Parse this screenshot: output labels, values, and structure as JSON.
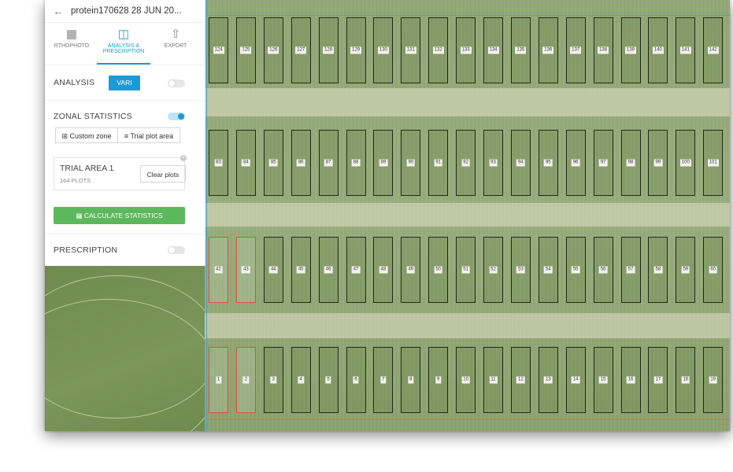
{
  "header": {
    "title": "protein170628 28 JUN 20..."
  },
  "tabs": [
    {
      "label": "RTHOPHOTO",
      "icon": "grid-map-icon"
    },
    {
      "label_line1": "ANALYSIS &",
      "label_line2": "PRESCRIPTION",
      "icon": "analysis-icon"
    },
    {
      "label": "EXPORT",
      "icon": "export-icon"
    }
  ],
  "analysis": {
    "label": "ANALYSIS",
    "index_button": "VARI",
    "enabled": false
  },
  "zonal": {
    "label": "ZONAL STATISTICS",
    "enabled": true,
    "custom_zone": "Custom zone",
    "trial_plot_area": "Trial plot area"
  },
  "trial": {
    "title": "TRIAL AREA 1",
    "subtitle": "164 PLOTS",
    "clear_label": "Clear plots"
  },
  "calc": {
    "label": "CALCULATE STATISTICS"
  },
  "prescription": {
    "label": "PRESCRIPTION",
    "enabled": false
  },
  "colors": {
    "accent": "#1a9bd6",
    "success": "#5cb85c",
    "selected_plot": "#d9533f",
    "plot_border": "#1e2a1a"
  },
  "plots": {
    "rows": [
      {
        "labels": [
          "124",
          "125",
          "126",
          "127",
          "128",
          "129",
          "130",
          "131",
          "132",
          "133",
          "134",
          "135",
          "136",
          "137",
          "138",
          "139",
          "140",
          "141",
          "142"
        ]
      },
      {
        "labels": [
          "83",
          "84",
          "85",
          "86",
          "87",
          "88",
          "89",
          "90",
          "91",
          "92",
          "93",
          "94",
          "95",
          "96",
          "97",
          "98",
          "99",
          "100",
          "101"
        ]
      },
      {
        "labels": [
          "42",
          "43",
          "44",
          "45",
          "46",
          "47",
          "48",
          "49",
          "50",
          "51",
          "52",
          "53",
          "54",
          "55",
          "56",
          "57",
          "58",
          "59",
          "60"
        ]
      },
      {
        "labels": [
          "1",
          "2",
          "3",
          "4",
          "5",
          "6",
          "7",
          "8",
          "9",
          "10",
          "11",
          "12",
          "13",
          "14",
          "15",
          "16",
          "17",
          "18",
          "19"
        ]
      }
    ],
    "selected": [
      "42",
      "43",
      "1",
      "2"
    ]
  }
}
